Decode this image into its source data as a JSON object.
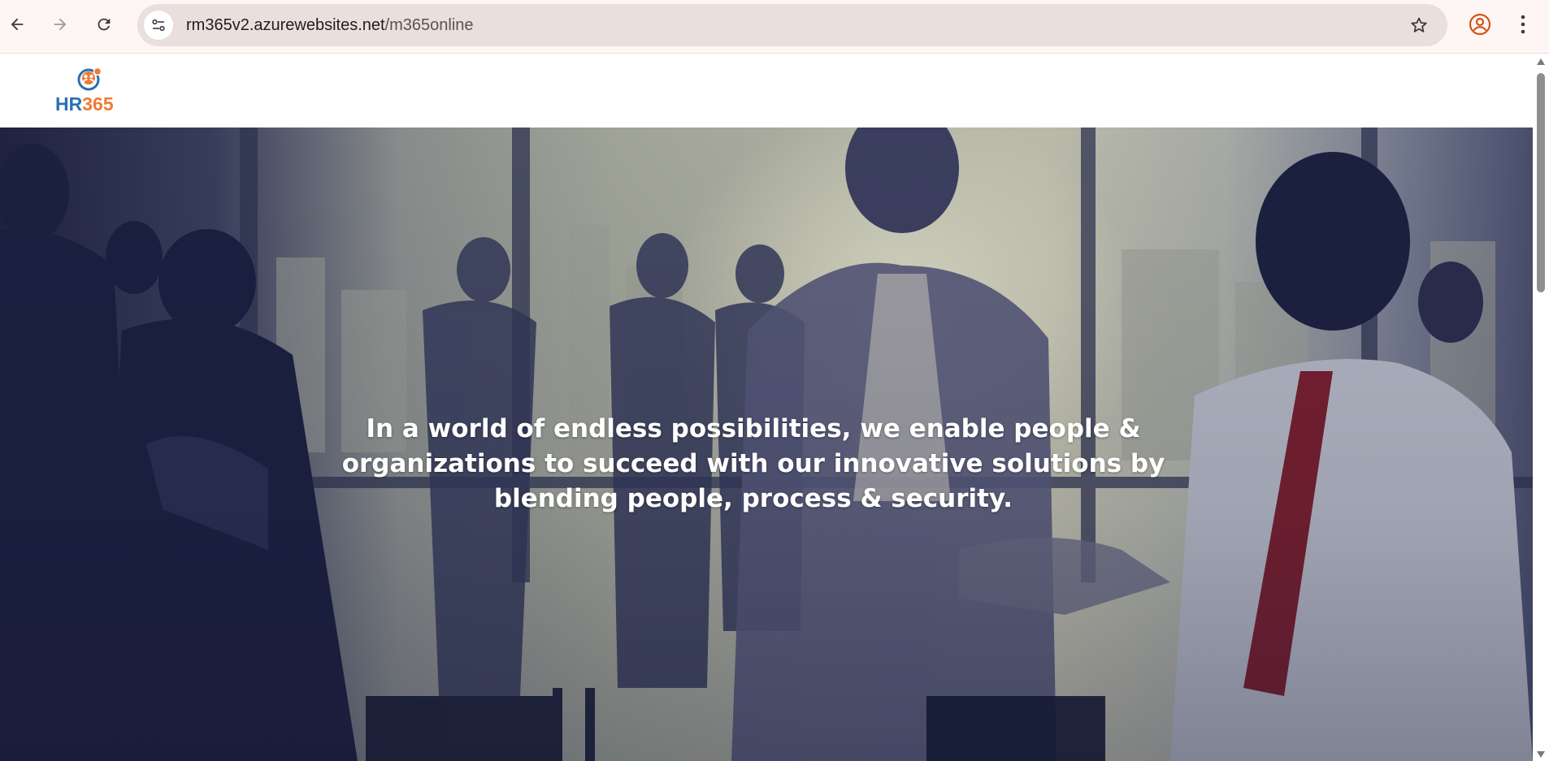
{
  "browser": {
    "url_host": "rm365v2.azurewebsites.net",
    "url_path": "/m365online",
    "icons": {
      "back": "arrow-left-icon",
      "forward": "arrow-right-icon",
      "reload": "reload-icon",
      "site_info": "tune-icon",
      "bookmark": "star-icon",
      "profile": "account-circle-icon",
      "menu": "more-vertical-icon"
    }
  },
  "site": {
    "logo": {
      "text_hr": "HR",
      "text_num": "365",
      "colors": {
        "hr": "#2a6fb3",
        "num": "#f07a35"
      }
    },
    "hero": {
      "headline": "In a world of endless possibilities, we enable people & organizations to succeed with our innovative solutions by blending people, process & security."
    }
  }
}
